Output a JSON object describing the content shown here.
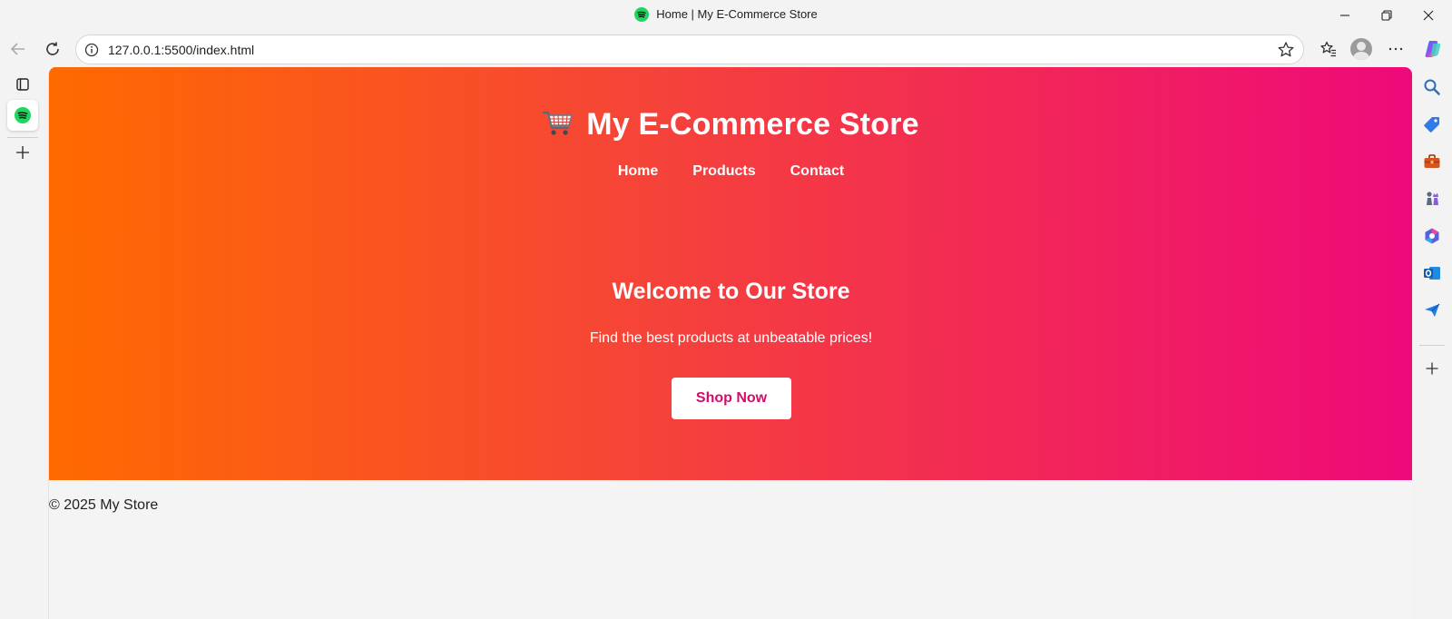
{
  "window": {
    "title": "Home | My E-Commerce Store"
  },
  "address_bar": {
    "url": "127.0.0.1:5500/index.html"
  },
  "page": {
    "site_title": "My E-Commerce Store",
    "nav": [
      "Home",
      "Products",
      "Contact"
    ],
    "hero_heading": "Welcome to Our Store",
    "hero_text": "Find the best products at unbeatable prices!",
    "cta_label": "Shop Now",
    "footer_text": "© 2025 My Store"
  },
  "colors": {
    "gradient_start": "#ff6a00",
    "gradient_end": "#ee0979",
    "cta_text": "#d10d6a",
    "spotify_green": "#1ed760"
  },
  "icons": {
    "left_strip": [
      "tab-actions-icon",
      "spotify-icon",
      "add-tab-icon"
    ],
    "right_sidebar": [
      "search-icon",
      "shopping-tag-icon",
      "tools-icon",
      "games-icon",
      "microsoft365-icon",
      "outlook-icon",
      "send-icon",
      "add-icon"
    ]
  }
}
